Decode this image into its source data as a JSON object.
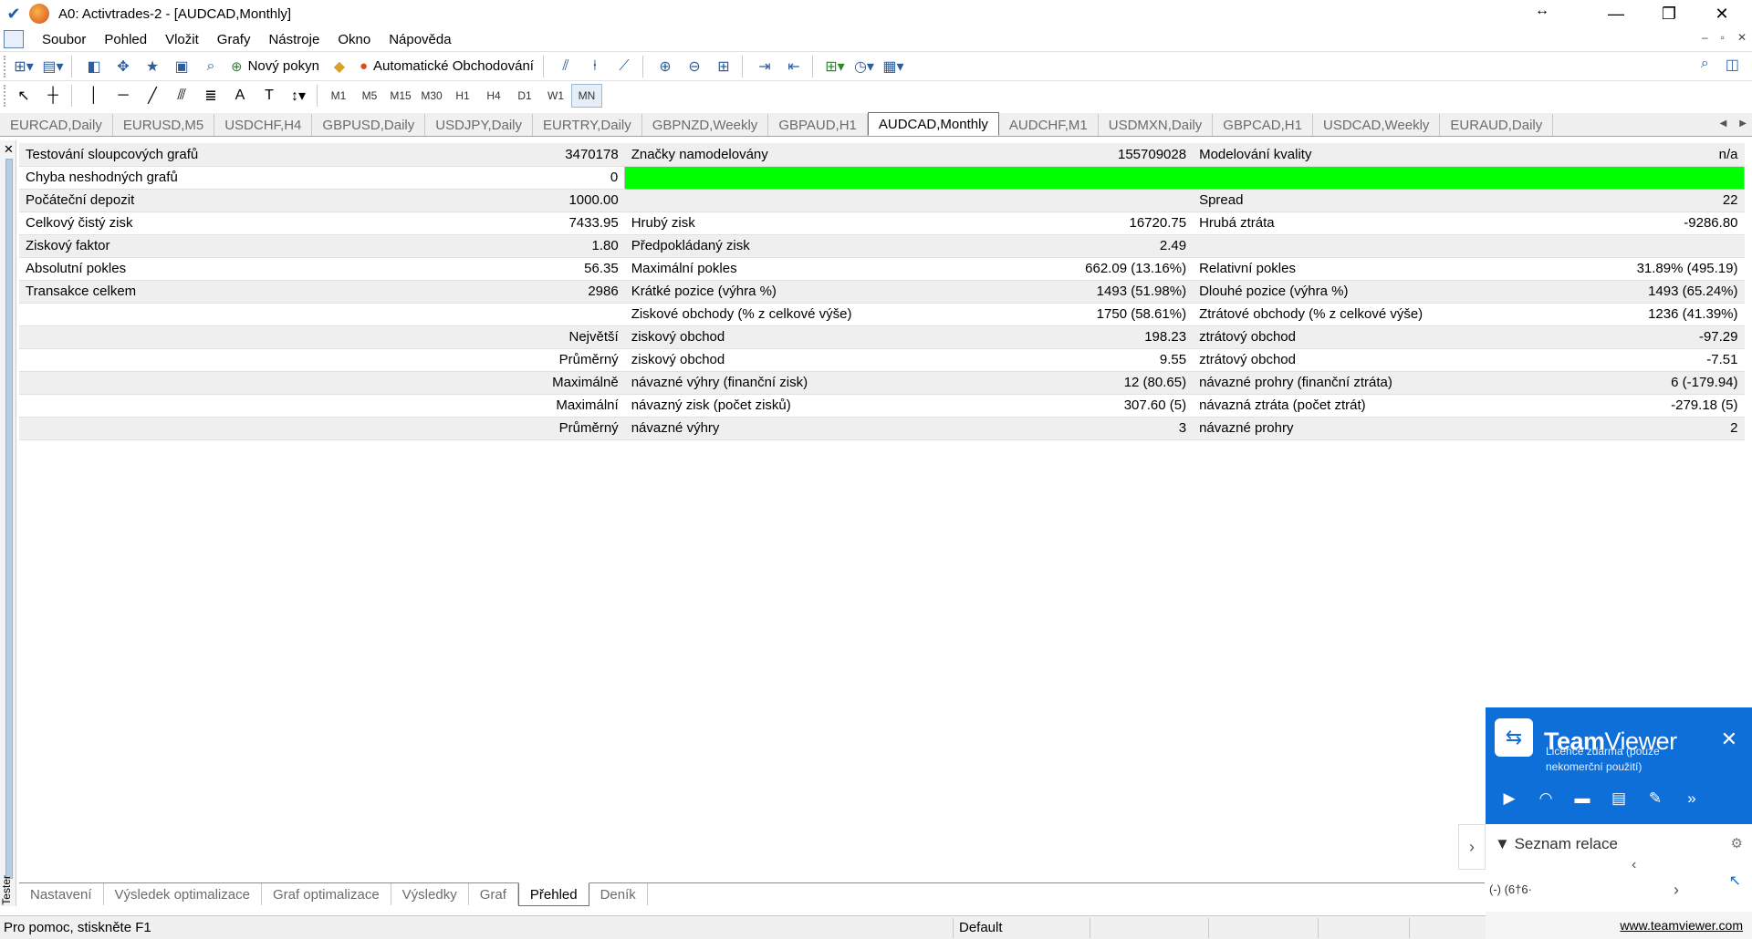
{
  "window": {
    "title": "A0: Activtrades-2 - [AUDCAD,Monthly]",
    "resize_glyph": "↔",
    "controls": [
      "—",
      "❐",
      "✕"
    ]
  },
  "menu": {
    "items": [
      "Soubor",
      "Pohled",
      "Vložit",
      "Grafy",
      "Nástroje",
      "Okno",
      "Nápověda"
    ],
    "mdi_controls": [
      "–",
      "▫",
      "✕"
    ]
  },
  "toolbar1": {
    "new_order": "Nový pokyn",
    "auto_trading": "Automatické Obchodování"
  },
  "toolbar2": {
    "timeframes": [
      "M1",
      "M5",
      "M15",
      "M30",
      "H1",
      "H4",
      "D1",
      "W1",
      "MN"
    ],
    "active_timeframe": "MN"
  },
  "chart_tabs": {
    "items": [
      "EURCAD,Daily",
      "EURUSD,M5",
      "USDCHF,H4",
      "GBPUSD,Daily",
      "USDJPY,Daily",
      "EURTRY,Daily",
      "GBPNZD,Weekly",
      "GBPAUD,H1",
      "AUDCAD,Monthly",
      "AUDCHF,M1",
      "USDMXN,Daily",
      "GBPCAD,H1",
      "USDCAD,Weekly",
      "EURAUD,Daily"
    ],
    "active": "AUDCAD,Monthly"
  },
  "tester": {
    "side_label": "Tester",
    "close": "✕",
    "rows": [
      [
        "Testování sloupcových grafů",
        "3470178",
        "Značky namodelovány",
        "155709028",
        "Modelování kvality",
        "n/a"
      ],
      [
        "Chyba neshodných grafů",
        "0",
        "",
        "",
        "",
        ""
      ],
      [
        "Počáteční depozit",
        "1000.00",
        "",
        "",
        "Spread",
        "22"
      ],
      [
        "Celkový čistý zisk",
        "7433.95",
        "Hrubý zisk",
        "16720.75",
        "Hrubá ztráta",
        "-9286.80"
      ],
      [
        "Ziskový faktor",
        "1.80",
        "Předpokládaný zisk",
        "2.49",
        "",
        ""
      ],
      [
        "Absolutní pokles",
        "56.35",
        "Maximální pokles",
        "662.09 (13.16%)",
        "Relativní pokles",
        "31.89% (495.19)"
      ],
      [
        "Transakce celkem",
        "2986",
        "Krátké pozice (výhra %)",
        "1493 (51.98%)",
        "Dlouhé pozice (výhra %)",
        "1493 (65.24%)"
      ],
      [
        "",
        "",
        "Ziskové obchody (% z celkové výše)",
        "1750 (58.61%)",
        "Ztrátové obchody (% z celkové výše)",
        "1236 (41.39%)"
      ],
      [
        "",
        "Největší",
        "ziskový obchod",
        "198.23",
        "ztrátový obchod",
        "-97.29"
      ],
      [
        "",
        "Průměrný",
        "ziskový obchod",
        "9.55",
        "ztrátový obchod",
        "-7.51"
      ],
      [
        "",
        "Maximálně",
        "návazné výhry (finanční zisk)",
        "12 (80.65)",
        "návazné prohry (finanční ztráta)",
        "6 (-179.94)"
      ],
      [
        "",
        "Maximální",
        "návazný zisk (počet zisků)",
        "307.60 (5)",
        "návazná ztráta (počet ztrát)",
        "-279.18 (5)"
      ],
      [
        "",
        "Průměrný",
        "návazné výhry",
        "3",
        "návazné prohry",
        "2"
      ]
    ],
    "quality_bar_color": "#00ff00"
  },
  "bottom_tabs": {
    "items": [
      "Nastavení",
      "Výsledek optimalizace",
      "Graf optimalizace",
      "Výsledky",
      "Graf",
      "Přehled",
      "Deník"
    ],
    "active": "Přehled"
  },
  "status": {
    "help": "Pro pomoc, stiskněte F1",
    "profile": "Default"
  },
  "teamviewer": {
    "brand_bold": "Team",
    "brand_light": "Viewer",
    "license": "Licence zdarma (pouze nekomerční použití)",
    "list_title": "Seznam relace",
    "entry": "(-)  (6†6·",
    "link": "www.teamviewer.com",
    "accent": "#0e6fd9"
  }
}
